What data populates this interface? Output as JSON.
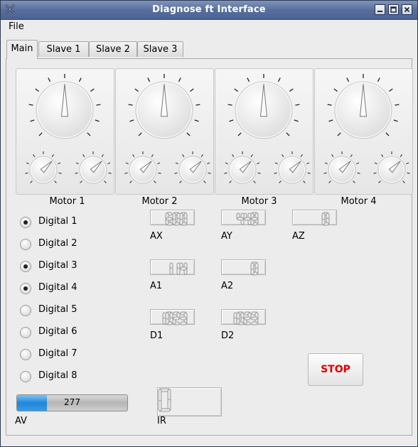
{
  "window": {
    "title": "Diagnose ft Interface",
    "colors": {
      "titlebar": "#586f9e",
      "stop_text": "#e00000",
      "progress_fill": "#1f86dc"
    }
  },
  "menu": {
    "file_label": "File"
  },
  "tabs": [
    {
      "label": "Main",
      "active": true
    },
    {
      "label": "Slave 1",
      "active": false
    },
    {
      "label": "Slave 2",
      "active": false
    },
    {
      "label": "Slave 3",
      "active": false
    }
  ],
  "motors": [
    {
      "label": "Motor 1"
    },
    {
      "label": "Motor 2"
    },
    {
      "label": "Motor 3"
    },
    {
      "label": "Motor 4"
    }
  ],
  "digitals": [
    {
      "label": "Digital 1",
      "checked": true
    },
    {
      "label": "Digital 2",
      "checked": false
    },
    {
      "label": "Digital 3",
      "checked": true
    },
    {
      "label": "Digital 4",
      "checked": true
    },
    {
      "label": "Digital 5",
      "checked": false
    },
    {
      "label": "Digital 6",
      "checked": false
    },
    {
      "label": "Digital 7",
      "checked": false
    },
    {
      "label": "Digital 8",
      "checked": false
    }
  ],
  "sensors": {
    "ax": {
      "label": "AX",
      "value": "600"
    },
    "ay": {
      "label": "AY",
      "value": "448"
    },
    "az": {
      "label": "AZ",
      "value": "0"
    },
    "a1": {
      "label": "A1",
      "value": "114"
    },
    "a2": {
      "label": "A2",
      "value": "0"
    },
    "d1": {
      "label": "D1",
      "value": "1023"
    },
    "d2": {
      "label": "D2",
      "value": "1023"
    },
    "ir": {
      "label": "IR",
      "value": "0"
    }
  },
  "av": {
    "label": "AV",
    "value": "277",
    "fill_fraction": 0.27
  },
  "stop_label": "STOP"
}
